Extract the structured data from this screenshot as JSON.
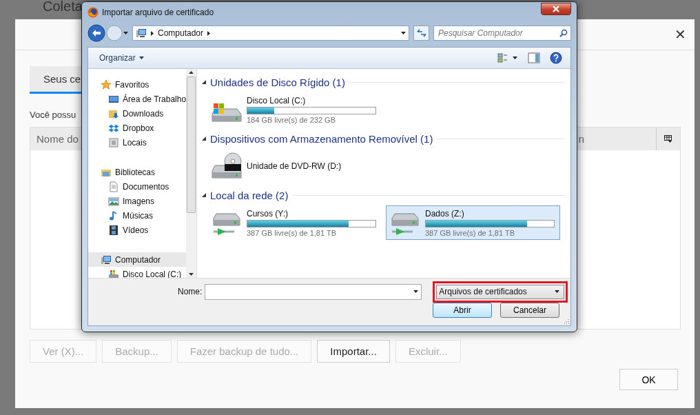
{
  "page_title": "Coleta",
  "manager": {
    "tabs": [
      {
        "label": "Seus ce",
        "selected": true
      }
    ],
    "message": "Você possu",
    "table": {
      "columns": [
        "Nome do",
        "n"
      ]
    },
    "buttons": [
      {
        "label": "Ver (X)...",
        "disabled": true
      },
      {
        "label": "Backup...",
        "disabled": true
      },
      {
        "label": "Fazer backup de tudo...",
        "disabled": true
      },
      {
        "label": "Importar...",
        "disabled": false
      },
      {
        "label": "Excluir...",
        "disabled": true
      }
    ],
    "ok_button": "OK",
    "close_glyph": "✕"
  },
  "file_dialog": {
    "title": "Importar arquivo de certificado",
    "address": {
      "crumb": "Computador"
    },
    "search": {
      "placeholder": "Pesquisar Computador"
    },
    "toolbar": {
      "organize": "Organizar"
    },
    "nav": [
      {
        "label": "Favoritos",
        "kind": "favorites",
        "selected": false,
        "children": [
          {
            "label": "Área de Trabalho",
            "kind": "desktop",
            "selected": false
          },
          {
            "label": "Downloads",
            "kind": "downloads",
            "selected": false
          },
          {
            "label": "Dropbox",
            "kind": "dropbox",
            "selected": false
          },
          {
            "label": "Locais",
            "kind": "places",
            "selected": false
          }
        ]
      },
      {
        "label": "Bibliotecas",
        "kind": "libraries",
        "selected": false,
        "children": [
          {
            "label": "Documentos",
            "kind": "documents",
            "selected": false
          },
          {
            "label": "Imagens",
            "kind": "images",
            "selected": false
          },
          {
            "label": "Músicas",
            "kind": "music",
            "selected": false
          },
          {
            "label": "Vídeos",
            "kind": "videos",
            "selected": false
          }
        ]
      },
      {
        "label": "Computador",
        "kind": "computer",
        "selected": true,
        "children": [
          {
            "label": "Disco Local (C:)",
            "kind": "disk",
            "selected": false
          }
        ]
      }
    ],
    "groups": [
      {
        "title": "Unidades de Disco Rígido (1)",
        "items": [
          {
            "name": "Disco Local (C:)",
            "kind": "disk",
            "level": 0.21,
            "free": "184 GB livre(s) de 232 GB",
            "selected": false
          }
        ]
      },
      {
        "title": "Dispositivos com Armazenamento Removível (1)",
        "items": [
          {
            "name": "Unidade de DVD-RW (D:)",
            "kind": "dvd",
            "selected": false
          }
        ]
      },
      {
        "title": "Local da rede (2)",
        "items": [
          {
            "name": "Cursos (Y:)",
            "kind": "network",
            "level": 0.79,
            "free": "387 GB livre(s) de 1,81 TB",
            "selected": false
          },
          {
            "name": "Dados (Z:)",
            "kind": "network",
            "level": 0.79,
            "free": "387 GB livre(s) de 1,81 TB",
            "selected": true
          }
        ]
      }
    ],
    "filename": {
      "label": "Nome:"
    },
    "filetype": {
      "value": "Arquivos de certificados",
      "highlighted": true
    },
    "buttons": [
      {
        "label": "Abrir",
        "default": true
      },
      {
        "label": "Cancelar",
        "default": false
      }
    ]
  }
}
